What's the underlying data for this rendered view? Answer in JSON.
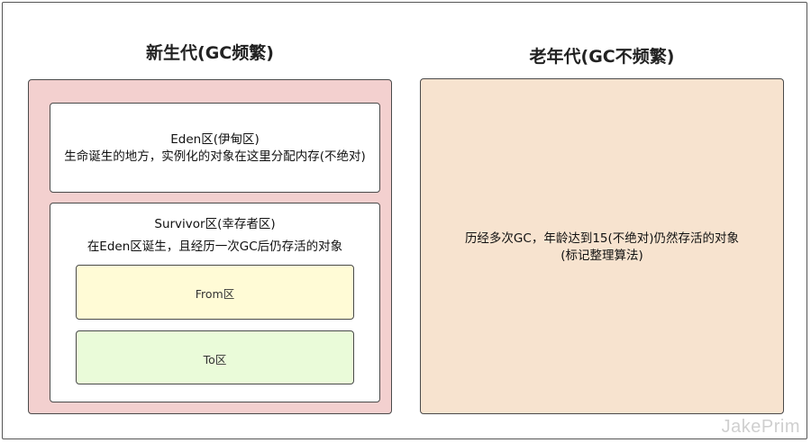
{
  "young_generation": {
    "title": "新生代(GC频繁)",
    "eden": {
      "title": "Eden区(伊甸区)",
      "description": "生命诞生的地方，实例化的对象在这里分配内存(不绝对)"
    },
    "survivor": {
      "title": "Survivor区(幸存者区)",
      "description": "在Eden区诞生，且经历一次GC后仍存活的对象",
      "from_label": "From区",
      "to_label": "To区"
    }
  },
  "old_generation": {
    "title": "老年代(GC不频繁)",
    "line1": "历经多次GC，年龄达到15(不绝对)仍然存活的对象",
    "line2": "(标记整理算法)"
  },
  "watermark": "JakePrim",
  "colors": {
    "young_bg": "#f3d0cf",
    "old_bg": "#f7e3cf",
    "from_bg": "#fffbd6",
    "to_bg": "#eafbd9",
    "border": "#4a4a4a"
  }
}
